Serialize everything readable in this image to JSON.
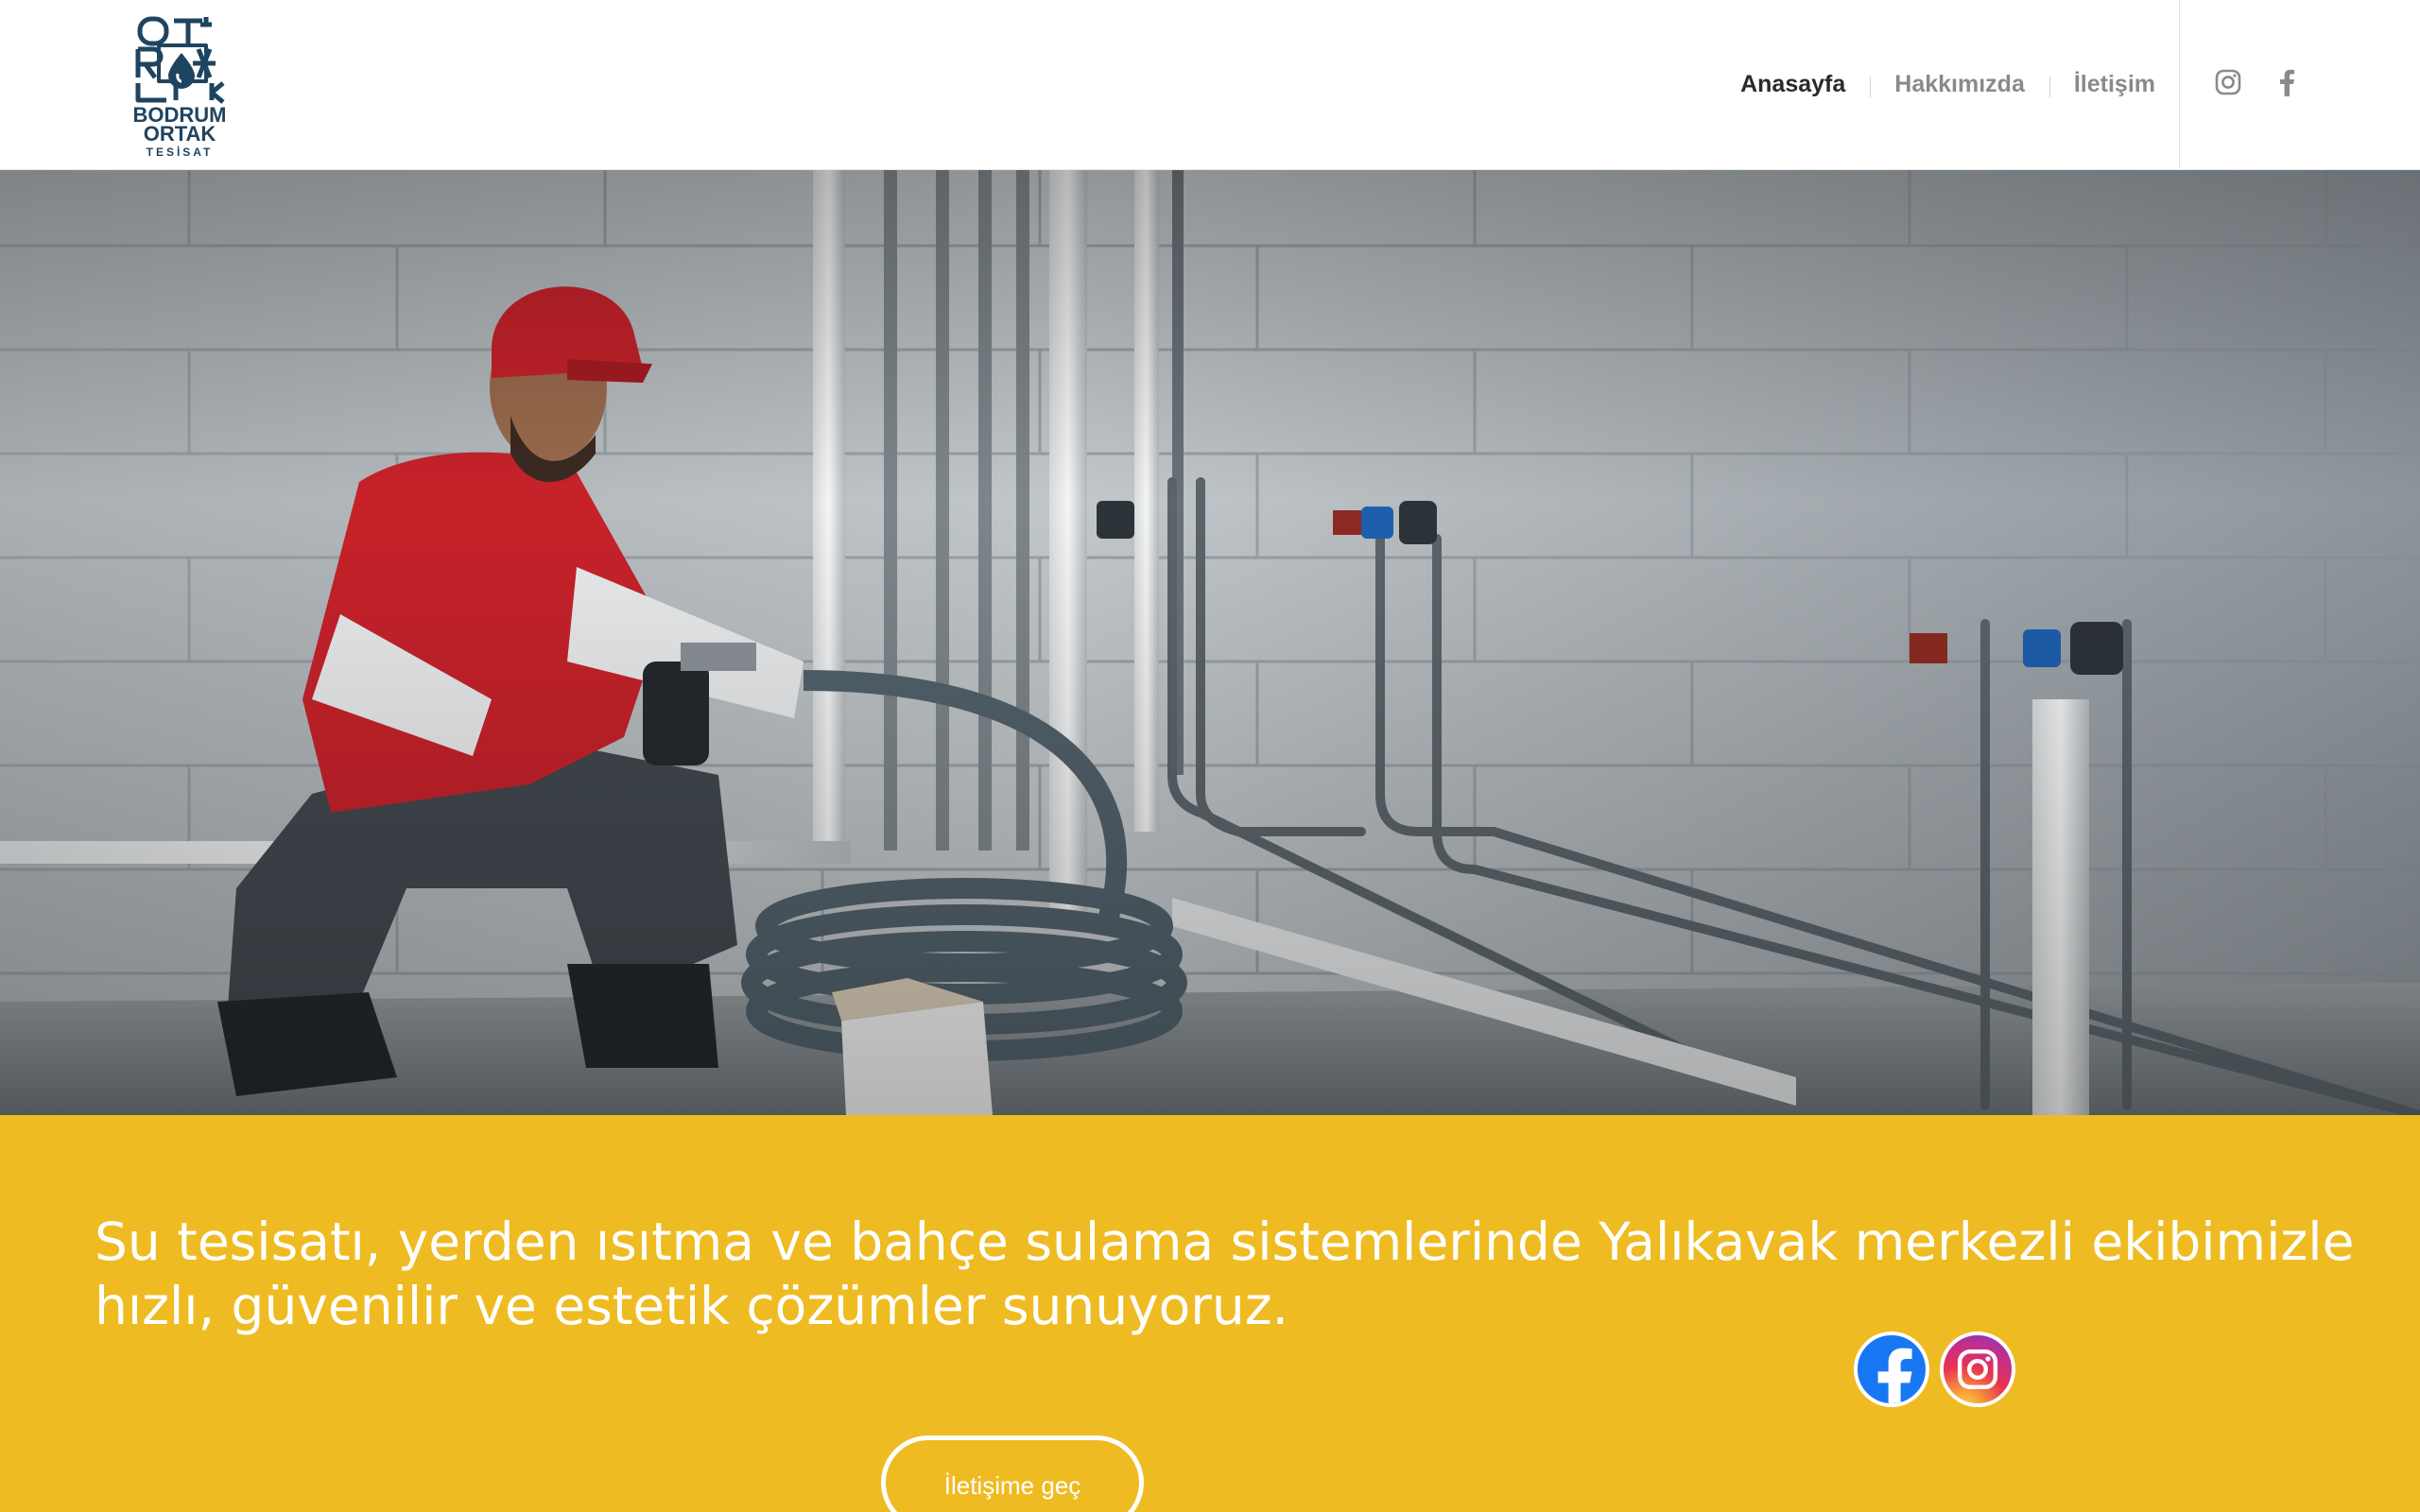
{
  "brand": {
    "logo_line1": "BODRUM",
    "logo_line2": "ORTAK",
    "logo_sub": "TESİSAT",
    "logo_color": "#1f4460"
  },
  "nav": {
    "items": [
      {
        "label": "Anasayfa",
        "active": true
      },
      {
        "label": "Hakkımızda",
        "active": false
      },
      {
        "label": "İletişim",
        "active": false
      }
    ]
  },
  "header_social": {
    "icons": [
      "instagram-icon",
      "facebook-icon"
    ]
  },
  "hero": {
    "image_subject": "plumber-kneeling-with-pipes"
  },
  "band": {
    "background": "#efbb22",
    "tagline": "Su tesisatı, yerden ısıtma ve bahçe sulama sistemlerinde Yalıkavak merkezli ekibimizle hızlı, güvenilir ve estetik çözümler sunuyoruz.",
    "social": [
      "facebook-icon",
      "instagram-icon"
    ],
    "cta_label": "İletişime geç"
  }
}
